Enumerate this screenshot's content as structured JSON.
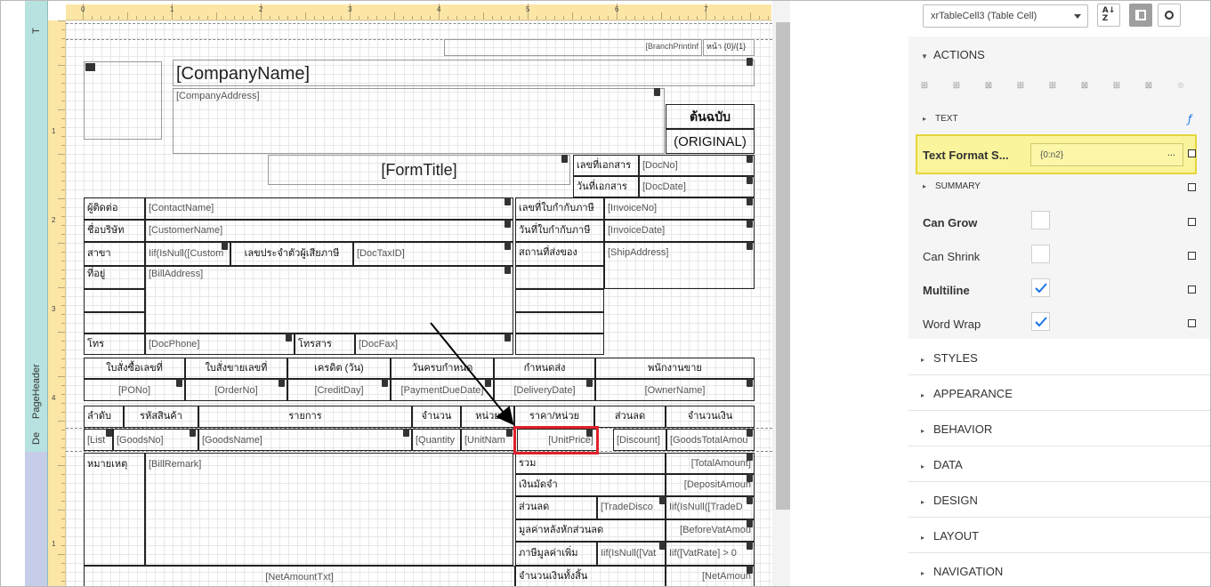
{
  "bands": {
    "top": "T",
    "page_header": "PageHeader",
    "detail": "De"
  },
  "ruler": {
    "h": [
      "0",
      "1",
      "2",
      "3",
      "4",
      "5",
      "6",
      "7"
    ],
    "v": [
      "1",
      "2",
      "3",
      "4",
      "1"
    ]
  },
  "report": {
    "branch": "[BranchPrintInf",
    "page": "หน้า {0}/{1}",
    "company_name": "[CompanyName]",
    "company_address": "[CompanyAddress]",
    "original_th": "ต้นฉบับ",
    "original_en": "(ORIGINAL)",
    "form_title": "[FormTitle]",
    "doc_no_label": "เลขที่เอกสาร",
    "doc_no": "[DocNo]",
    "doc_date_label": "วันที่เอกสาร",
    "doc_date": "[DocDate]",
    "contact_label": "ผู้ติดต่อ",
    "contact": "[ContactName]",
    "customer_label": "ชื่อบริษัท",
    "customer": "[CustomerName]",
    "branch_label": "สาขา",
    "branch_value": "Iif(IsNull([Custom",
    "taxid_label": "เลขประจำตัวผู้เสียภาษี",
    "taxid": "[DocTaxID]",
    "address_label": "ที่อยู่",
    "address": "[BillAddress]",
    "phone_label": "โทร",
    "phone": "[DocPhone]",
    "fax_label": "โทรสาร",
    "fax": "[DocFax]",
    "invoice_no_label": "เลขที่ใบกำกับภาษี",
    "invoice_no": "[InvoiceNo]",
    "invoice_date_label": "วันที่ใบกำกับภาษี",
    "invoice_date": "[InvoiceDate]",
    "ship_label": "สถานที่ส่งของ",
    "ship": "[ShipAddress]",
    "po_label": "ใบสั่งซื้อเลขที่",
    "po": "[PONo]",
    "order_label": "ใบสั่งขายเลขที่",
    "order": "[OrderNo]",
    "credit_label": "เครดิต (วัน)",
    "credit": "[CreditDay]",
    "due_label": "วันครบกำหนด",
    "due": "[PaymentDueDate]",
    "delivery_label": "กำหนดส่ง",
    "delivery": "[DeliveryDate]",
    "owner_label": "พนักงานขาย",
    "owner": "[OwnerName]",
    "col_seq": "ลำดับ",
    "col_code": "รหัสสินค้า",
    "col_name": "รายการ",
    "col_qty": "จำนวน",
    "col_unit": "หน่วย",
    "col_price": "ราคา/หน่วย",
    "col_disc": "ส่วนลด",
    "col_amount": "จำนวนเงิน",
    "cell_seq": "[List",
    "cell_code": "[GoodsNo]",
    "cell_name": "[GoodsName]",
    "cell_qty": "[Quantity",
    "cell_unit": "[UnitNam",
    "cell_price": "[UnitPrice]",
    "cell_disc": "[Discount]",
    "cell_amount": "[GoodsTotalAmou",
    "remark_label": "หมายเหตุ",
    "remark": "[BillRemark]",
    "total_label": "รวม",
    "total": "[TotalAmount]",
    "deposit_label": "เงินมัดจำ",
    "deposit": "[DepositAmoun",
    "discount_label": "ส่วนลด",
    "trade_disc": "[TradeDisco",
    "trade_disc2": "Iif(IsNull([TradeD",
    "before_vat_label": "มูลค่าหลังหักส่วนลด",
    "before_vat": "[BeforeVatAmou",
    "vat_label": "ภาษีมูลค่าเพิ่ม",
    "vat1": "Iif(IsNull([Vat",
    "vat2": "Iif([VatRate] > 0",
    "net_txt": "[NetAmountTxt]",
    "net_label": "จำนวนเงินทั้งสิ้น",
    "net": "[NetAmoun"
  },
  "panel": {
    "selector": "xrTableCell3 (Table Cell)",
    "sort_icon": "sort-az-icon",
    "categories_icon": "categories-icon",
    "search_icon": "search-icon",
    "actions": "ACTIONS",
    "text": "TEXT",
    "text_format_label": "Text Format S...",
    "text_format_value": "{0:n2}",
    "ellipsis": "...",
    "summary": "SUMMARY",
    "can_grow": "Can Grow",
    "can_shrink": "Can Shrink",
    "multiline": "Multiline",
    "word_wrap": "Word Wrap",
    "sections": [
      "STYLES",
      "APPEARANCE",
      "BEHAVIOR",
      "DATA",
      "DESIGN",
      "LAYOUT",
      "NAVIGATION"
    ],
    "accent": "#1a73e8",
    "highlight": "#faf59c",
    "annotation": "#e0202a"
  }
}
